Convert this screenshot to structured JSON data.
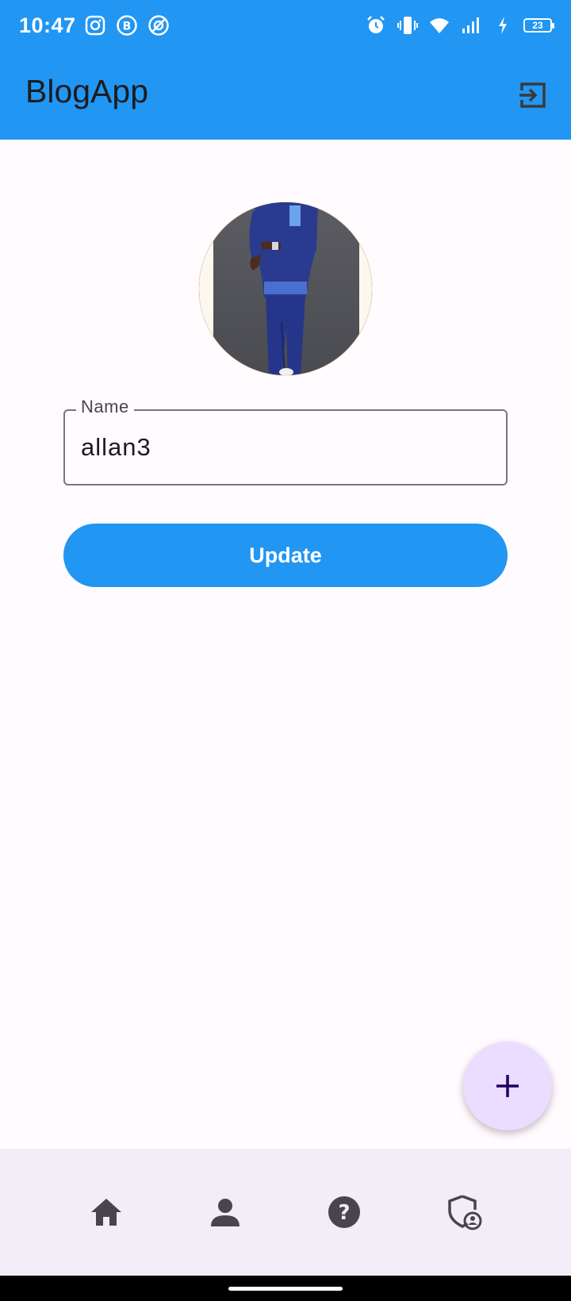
{
  "status_bar": {
    "time": "10:47",
    "battery_level": "23",
    "left_icons": [
      "instagram-icon",
      "business-b-icon",
      "circle-slash-icon"
    ],
    "right_icons": [
      "alarm-icon",
      "vibrate-icon",
      "wifi-icon",
      "signal-icon",
      "charging-icon"
    ]
  },
  "app_bar": {
    "title": "BlogApp",
    "action_icon": "logout-icon",
    "background": "#2196f3"
  },
  "profile": {
    "avatar_icon": "profile-photo"
  },
  "form": {
    "name_label": "Name",
    "name_value": "allan3",
    "update_label": "Update"
  },
  "fab": {
    "icon": "add-icon",
    "background": "#eaddff"
  },
  "bottom_nav": {
    "items": [
      {
        "icon": "home-icon"
      },
      {
        "icon": "person-icon"
      },
      {
        "icon": "help-icon"
      },
      {
        "icon": "admin-shield-icon"
      }
    ],
    "background": "#f3edf7"
  }
}
